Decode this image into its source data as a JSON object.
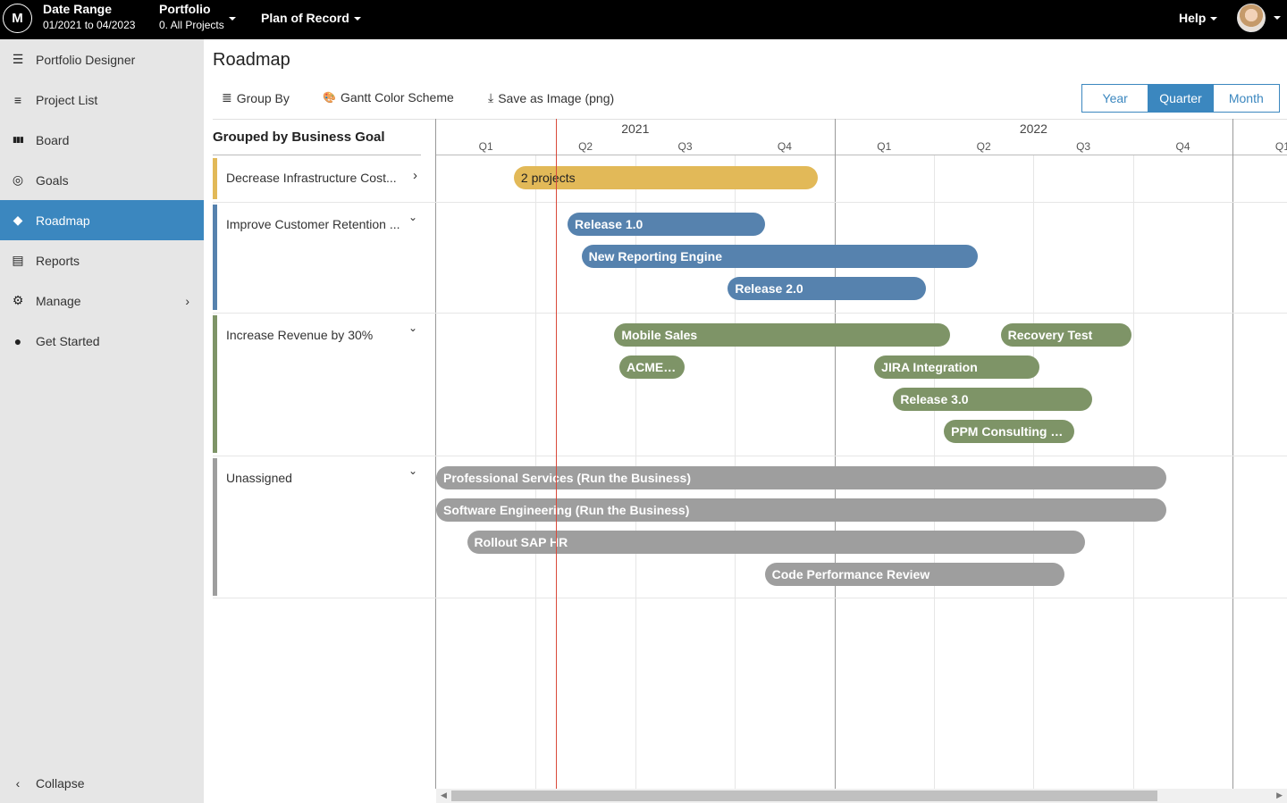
{
  "topbar": {
    "logo": "M",
    "date_range": {
      "title": "Date Range",
      "value": "01/2021 to 04/2023"
    },
    "portfolio": {
      "title": "Portfolio",
      "value": "0. All Projects"
    },
    "plan": "Plan of Record",
    "help": "Help"
  },
  "sidebar": {
    "items": [
      {
        "label": "Portfolio Designer",
        "icon": "☰"
      },
      {
        "label": "Project List",
        "icon": "≡"
      },
      {
        "label": "Board",
        "icon": "▮▮▮"
      },
      {
        "label": "Goals",
        "icon": "◎"
      },
      {
        "label": "Roadmap",
        "icon": "◆"
      },
      {
        "label": "Reports",
        "icon": "▤"
      },
      {
        "label": "Manage",
        "icon": "⚙",
        "chevron": "›"
      },
      {
        "label": "Get Started",
        "icon": "●"
      }
    ],
    "collapse": {
      "label": "Collapse",
      "icon": "‹"
    }
  },
  "page": {
    "title": "Roadmap"
  },
  "toolbar": {
    "group_by": "Group By",
    "color_scheme": "Gantt Color Scheme",
    "save_image": "Save as Image (png)",
    "icons": {
      "group_by": "≣",
      "color_scheme": "🎨",
      "save_image": "⤓"
    }
  },
  "view_toggle": {
    "options": [
      "Year",
      "Quarter",
      "Month"
    ],
    "selected": "Quarter"
  },
  "left_header": "Grouped by Business Goal",
  "timeline": {
    "years": [
      "2021",
      "2022"
    ],
    "quarters": [
      "Q1",
      "Q2",
      "Q3",
      "Q4",
      "Q1",
      "Q2",
      "Q3",
      "Q4",
      "Q1"
    ]
  },
  "colors": {
    "accent": "#3b87bf",
    "yellow": "#e2b958",
    "blue": "#5682ae",
    "green": "#7e9467",
    "gray": "#9e9e9e",
    "today": "#d9493a"
  },
  "groups": [
    {
      "name": "Decrease Infrastructure Cost...",
      "color": "yellow",
      "chevron": "›",
      "collapsed": true
    },
    {
      "name": "Improve Customer Retention ...",
      "color": "blue",
      "chevron": "⌄",
      "collapsed": false
    },
    {
      "name": "Increase Revenue by 30%",
      "color": "green",
      "chevron": "⌄",
      "collapsed": false
    },
    {
      "name": "Unassigned",
      "color": "gray",
      "chevron": "⌄",
      "collapsed": false
    }
  ],
  "bars": [
    {
      "label": "2 projects",
      "group": 0,
      "start_q": 0.78,
      "end_q": 3.83,
      "summary": true
    },
    {
      "label": "Release 1.0",
      "group": 1,
      "start_q": 1.32,
      "end_q": 3.3
    },
    {
      "label": "New Reporting Engine",
      "group": 1,
      "start_q": 1.46,
      "end_q": 5.44
    },
    {
      "label": "Release 2.0",
      "group": 1,
      "start_q": 2.93,
      "end_q": 4.92
    },
    {
      "label": "Mobile Sales",
      "group": 2,
      "start_q": 1.79,
      "end_q": 5.16
    },
    {
      "label": "Recovery Test",
      "group": 2,
      "start_q": 5.67,
      "end_q": 6.98
    },
    {
      "label": "ACME In...",
      "group": 2,
      "start_q": 1.84,
      "end_q": 2.5
    },
    {
      "label": "JIRA Integration",
      "group": 2,
      "start_q": 4.4,
      "end_q": 6.06
    },
    {
      "label": "Release 3.0",
      "group": 2,
      "start_q": 4.59,
      "end_q": 6.59
    },
    {
      "label": "PPM Consulting Pro...",
      "group": 2,
      "start_q": 5.1,
      "end_q": 6.41
    },
    {
      "label": "Professional Services (Run the Business)",
      "group": 3,
      "start_q": 0.0,
      "end_q": 7.33
    },
    {
      "label": "Software Engineering (Run the Business)",
      "group": 3,
      "start_q": 0.0,
      "end_q": 7.33
    },
    {
      "label": "Rollout SAP HR",
      "group": 3,
      "start_q": 0.31,
      "end_q": 6.52
    },
    {
      "label": "Code Performance Review",
      "group": 3,
      "start_q": 3.3,
      "end_q": 6.31
    }
  ],
  "today_q": 1.2
}
